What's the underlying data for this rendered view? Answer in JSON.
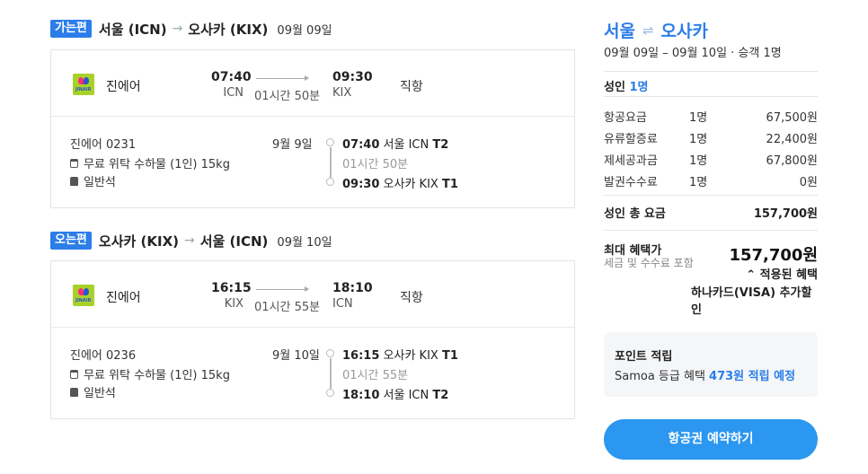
{
  "outbound": {
    "badge": "가는편",
    "route_from": "서울 (ICN)",
    "arrow": "→",
    "route_to": "오사카 (KIX)",
    "date": "09월 09일",
    "airline": "진에어",
    "logo_text": "JINAIR",
    "dep_time": "07:40",
    "dep_code": "ICN",
    "duration": "01시간 50분",
    "arr_time": "09:30",
    "arr_code": "KIX",
    "nonstop": "직항",
    "flight_no": "진에어 0231",
    "baggage": "무료 위탁 수하물 (1인) 15kg",
    "cabin": "일반석",
    "day": "9월 9일",
    "tl_dep_time": "07:40",
    "tl_dep_city": "서울 ICN",
    "tl_dep_term": "T2",
    "tl_duration": "01시간 50분",
    "tl_arr_time": "09:30",
    "tl_arr_city": "오사카 KIX",
    "tl_arr_term": "T1"
  },
  "inbound": {
    "badge": "오는편",
    "route_from": "오사카 (KIX)",
    "arrow": "→",
    "route_to": "서울 (ICN)",
    "date": "09월 10일",
    "airline": "진에어",
    "logo_text": "JINAIR",
    "dep_time": "16:15",
    "dep_code": "KIX",
    "duration": "01시간 55분",
    "arr_time": "18:10",
    "arr_code": "ICN",
    "nonstop": "직항",
    "flight_no": "진에어 0236",
    "baggage": "무료 위탁 수하물 (1인) 15kg",
    "cabin": "일반석",
    "day": "9월 10일",
    "tl_dep_time": "16:15",
    "tl_dep_city": "오사카 KIX",
    "tl_dep_term": "T1",
    "tl_duration": "01시간 55분",
    "tl_arr_time": "18:10",
    "tl_arr_city": "서울 ICN",
    "tl_arr_term": "T2"
  },
  "summary": {
    "from": "서울",
    "swap": "⇌",
    "to": "오사카",
    "subtitle": "09월 09일 – 09월 10일 · 승객 1명",
    "adult_label": "성인",
    "adult_count": "1명",
    "fees": [
      {
        "name": "항공요금",
        "count": "1명",
        "amount": "67,500원"
      },
      {
        "name": "유류할증료",
        "count": "1명",
        "amount": "22,400원"
      },
      {
        "name": "제세공과금",
        "count": "1명",
        "amount": "67,800원"
      },
      {
        "name": "발권수수료",
        "count": "1명",
        "amount": "0원"
      }
    ],
    "total_label": "성인 총 요금",
    "total_amount": "157,700원",
    "max_label": "최대 혜택가",
    "max_sub": "세금 및 수수료 포함",
    "max_amount": "157,700원",
    "applied": "⌃ 적용된 혜택",
    "card_discount": "하나카드(VISA) 추가할인",
    "point_title": "포인트 적립",
    "point_prefix": "Samoa 등급 혜택 ",
    "point_value": "473원 적립 예정",
    "book_button": "항공권 예약하기"
  },
  "colors": {
    "accent": "#2b7de9",
    "button": "#2b97f0"
  }
}
